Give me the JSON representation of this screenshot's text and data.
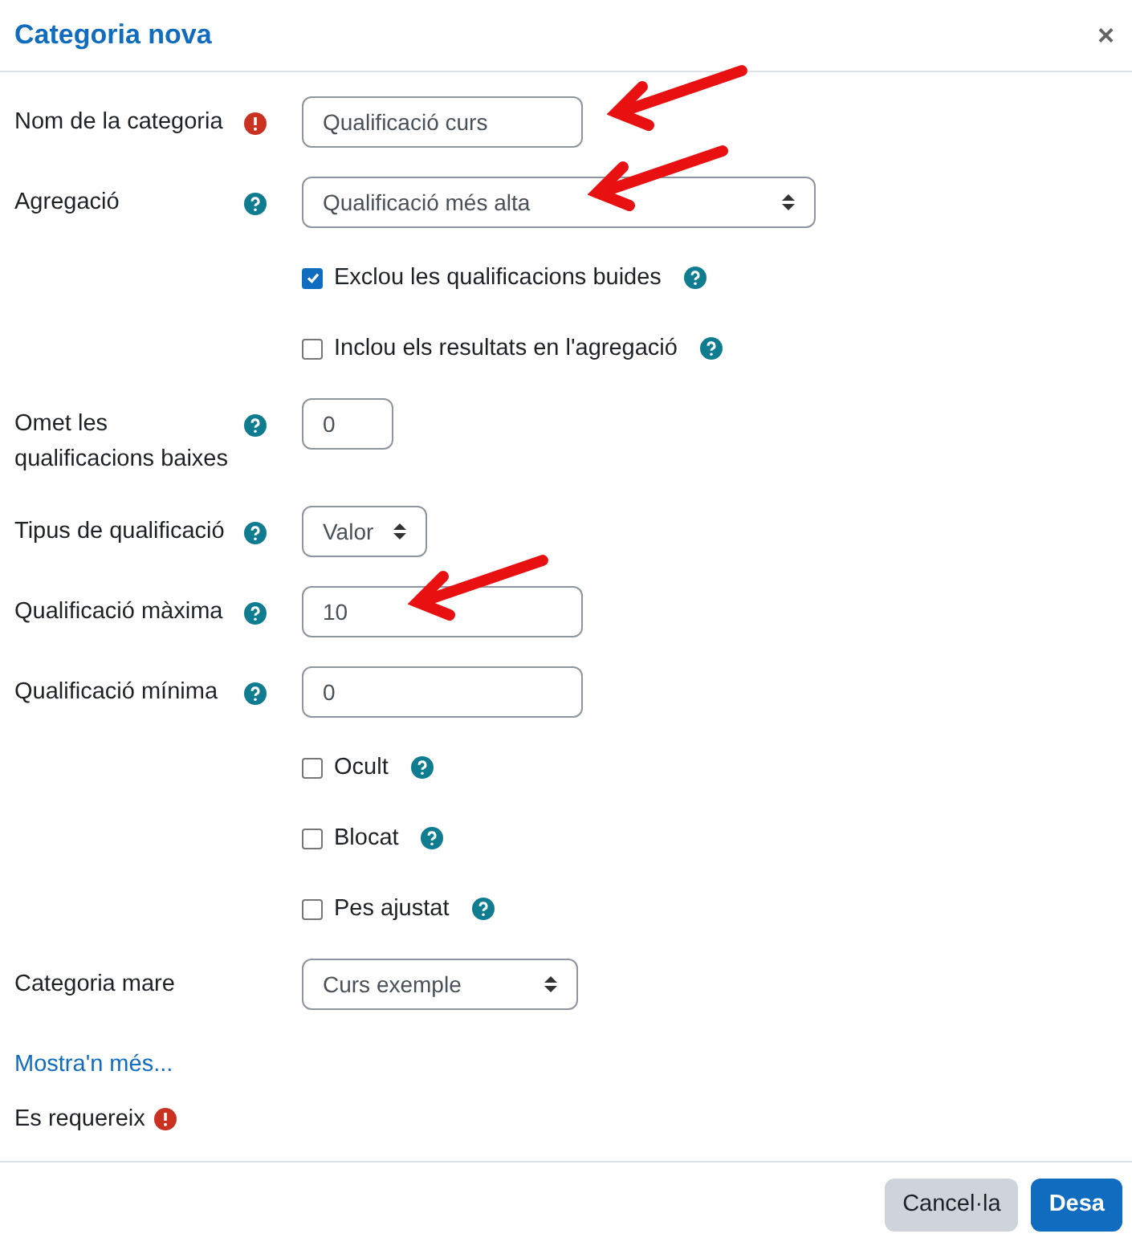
{
  "dialog": {
    "title": "Categoria nova",
    "close": "×"
  },
  "fields": [
    {
      "kind": "text",
      "label": "Nom de la categoria",
      "required": true,
      "value": "Qualificació curs",
      "arrow": true
    },
    {
      "kind": "select",
      "label": "Agregació",
      "help": true,
      "value": "Qualificació més alta",
      "arrow": true
    },
    {
      "kind": "checkbox",
      "label": "Exclou les qualificacions buides",
      "help": true,
      "checked": true
    },
    {
      "kind": "checkbox",
      "label": "Inclou els resultats en l'agregació",
      "help": true,
      "checked": false
    },
    {
      "kind": "text",
      "label": "Omet les qualificacions baixes",
      "help": true,
      "value": "0"
    },
    {
      "kind": "select",
      "label": "Tipus de qualificació",
      "help": true,
      "value": "Valor"
    },
    {
      "kind": "text",
      "label": "Qualificació màxima",
      "help": true,
      "value": "10",
      "arrow": true
    },
    {
      "kind": "text",
      "label": "Qualificació mínima",
      "help": true,
      "value": "0"
    },
    {
      "kind": "checkbox",
      "label": "Ocult",
      "help": true,
      "checked": false
    },
    {
      "kind": "checkbox",
      "label": "Blocat",
      "help": true,
      "checked": false
    },
    {
      "kind": "checkbox",
      "label": "Pes ajustat",
      "help": true,
      "checked": false
    },
    {
      "kind": "select",
      "label": "Categoria mare",
      "value": "Curs exemple"
    }
  ],
  "more_link": "Mostra'n més...",
  "required_note": "Es requereix",
  "buttons": [
    {
      "label": "Cancel·la",
      "kind": "secondary"
    },
    {
      "label": "Desa",
      "kind": "primary"
    }
  ]
}
